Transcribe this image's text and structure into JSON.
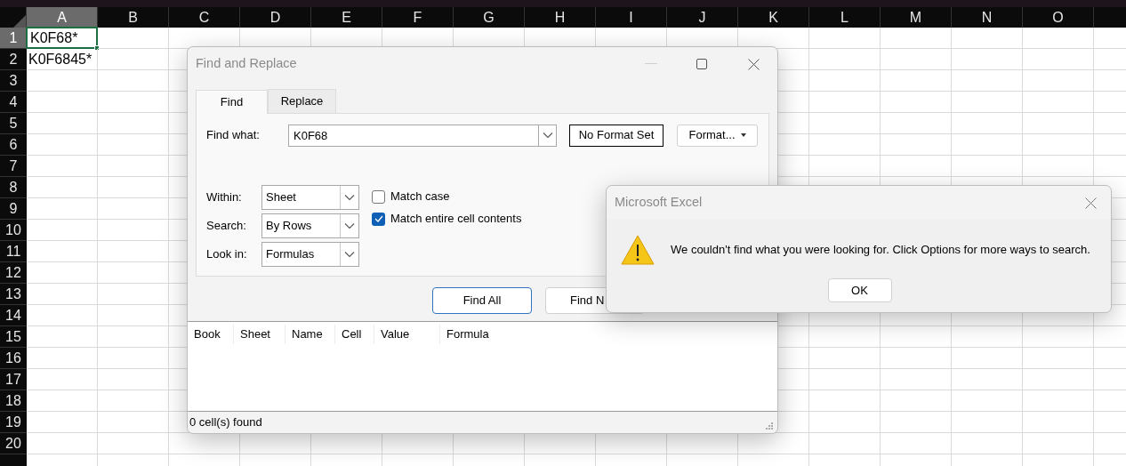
{
  "spreadsheet": {
    "columns": [
      {
        "label": "A",
        "selected": true
      },
      {
        "label": "B",
        "selected": false
      },
      {
        "label": "C",
        "selected": false
      },
      {
        "label": "D",
        "selected": false
      },
      {
        "label": "E",
        "selected": false
      },
      {
        "label": "F",
        "selected": false
      },
      {
        "label": "G",
        "selected": false
      },
      {
        "label": "H",
        "selected": false
      },
      {
        "label": "I",
        "selected": false
      },
      {
        "label": "J",
        "selected": false
      },
      {
        "label": "K",
        "selected": false
      },
      {
        "label": "L",
        "selected": false
      },
      {
        "label": "M",
        "selected": false
      },
      {
        "label": "N",
        "selected": false
      },
      {
        "label": "O",
        "selected": false
      }
    ],
    "rows": [
      {
        "label": "1",
        "selected": true,
        "cells": [
          {
            "text": "K0F68*",
            "active": true
          }
        ]
      },
      {
        "label": "2",
        "selected": false,
        "cells": [
          {
            "text": "K0F6845*",
            "active": false
          }
        ]
      },
      {
        "label": "3",
        "selected": false
      },
      {
        "label": "4",
        "selected": false
      },
      {
        "label": "5",
        "selected": false
      },
      {
        "label": "6",
        "selected": false
      },
      {
        "label": "7",
        "selected": false
      },
      {
        "label": "8",
        "selected": false
      },
      {
        "label": "9",
        "selected": false
      },
      {
        "label": "10",
        "selected": false
      },
      {
        "label": "11",
        "selected": false
      },
      {
        "label": "12",
        "selected": false
      },
      {
        "label": "13",
        "selected": false
      },
      {
        "label": "14",
        "selected": false
      },
      {
        "label": "15",
        "selected": false
      },
      {
        "label": "16",
        "selected": false
      },
      {
        "label": "17",
        "selected": false
      },
      {
        "label": "18",
        "selected": false
      },
      {
        "label": "19",
        "selected": false
      },
      {
        "label": "20",
        "selected": false
      }
    ]
  },
  "find_dialog": {
    "title": "Find and Replace",
    "tabs": [
      {
        "label": "Find",
        "selected": true
      },
      {
        "label": "Replace",
        "selected": false
      }
    ],
    "find_what": {
      "label": "Find what:",
      "value": "K0F68"
    },
    "format_status": "No Format Set",
    "format_button": "Format...",
    "dropdowns": [
      {
        "label": "Within:",
        "value": "Sheet"
      },
      {
        "label": "Search:",
        "value": "By Rows"
      },
      {
        "label": "Look in:",
        "value": "Formulas"
      }
    ],
    "checkboxes": [
      {
        "label": "Match case",
        "checked": false
      },
      {
        "label": "Match entire cell contents",
        "checked": true
      }
    ],
    "buttons": [
      "Find All",
      "Find N"
    ],
    "results_columns": [
      "Book",
      "Sheet",
      "Name",
      "Cell",
      "Value",
      "Formula"
    ],
    "status": "0 cell(s) found"
  },
  "message_box": {
    "title": "Microsoft Excel",
    "message": "We couldn't find what you were looking for. Click Options for more ways to search.",
    "buttons": [
      "OK"
    ]
  }
}
